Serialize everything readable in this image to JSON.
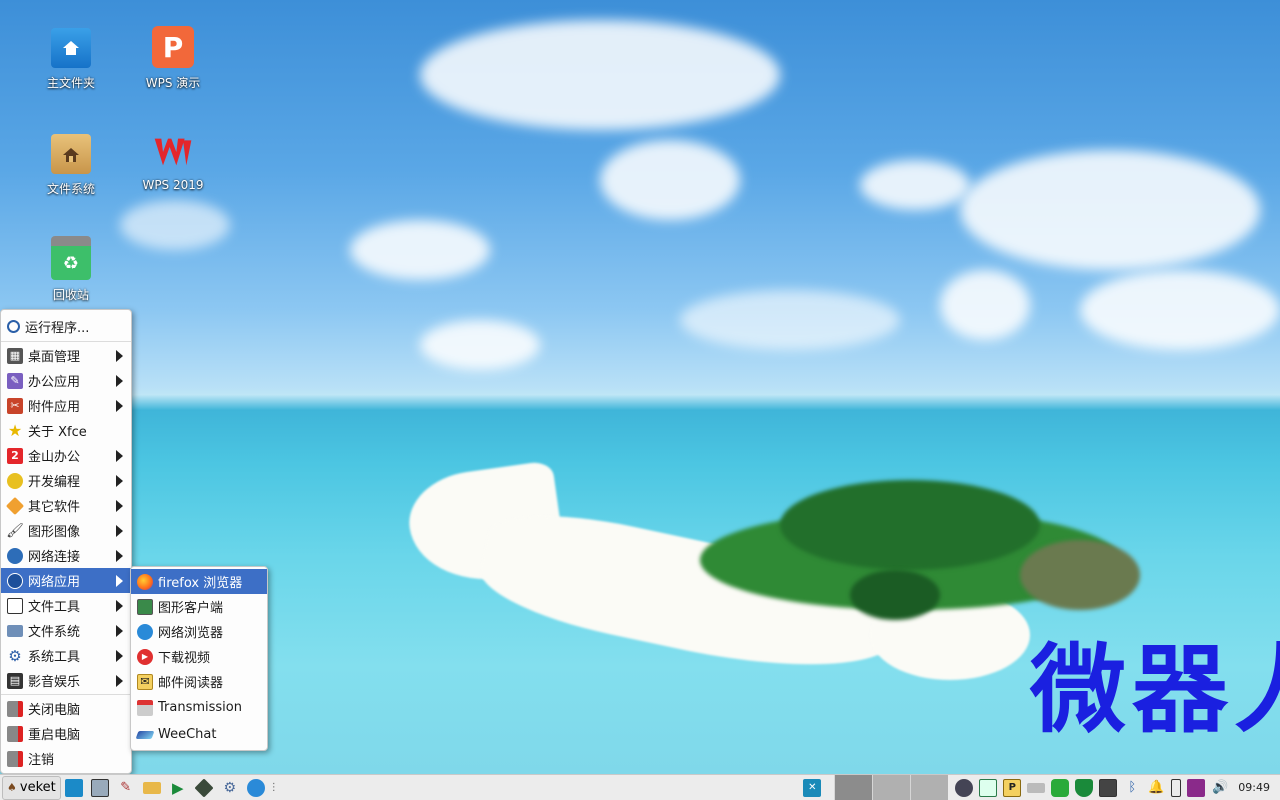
{
  "desktop": {
    "icons": [
      {
        "label": "主文件夹",
        "icon": "home-folder-icon"
      },
      {
        "label": "WPS 演示",
        "icon": "wps-presentation-icon"
      },
      {
        "label": "文件系统",
        "icon": "filesystem-icon"
      },
      {
        "label": "WPS 2019",
        "icon": "wps-icon"
      },
      {
        "label": "回收站",
        "icon": "trash-icon"
      }
    ],
    "watermark": "微器人"
  },
  "main_menu": {
    "run_program": "运行程序...",
    "items": [
      {
        "label": "桌面管理",
        "icon": "desktop-settings-icon",
        "submenu": true
      },
      {
        "label": "办公应用",
        "icon": "office-icon",
        "submenu": true
      },
      {
        "label": "附件应用",
        "icon": "accessories-icon",
        "submenu": true
      },
      {
        "label": "关于 Xfce",
        "icon": "star-icon",
        "submenu": false
      },
      {
        "label": "金山办公",
        "icon": "wps-office-icon",
        "submenu": true
      },
      {
        "label": "开发编程",
        "icon": "development-icon",
        "submenu": true
      },
      {
        "label": "其它软件",
        "icon": "other-software-icon",
        "submenu": true
      },
      {
        "label": "图形图像",
        "icon": "graphics-icon",
        "submenu": true
      },
      {
        "label": "网络连接",
        "icon": "network-connection-icon",
        "submenu": true
      },
      {
        "label": "网络应用",
        "icon": "internet-apps-icon",
        "submenu": true,
        "active": true
      },
      {
        "label": "文件工具",
        "icon": "file-tools-icon",
        "submenu": true
      },
      {
        "label": "文件系统",
        "icon": "folder-icon",
        "submenu": true
      },
      {
        "label": "系统工具",
        "icon": "system-tools-icon",
        "submenu": true
      },
      {
        "label": "影音娱乐",
        "icon": "multimedia-icon",
        "submenu": true
      }
    ],
    "session": [
      {
        "label": "关闭电脑",
        "icon": "shutdown-icon"
      },
      {
        "label": "重启电脑",
        "icon": "reboot-icon"
      },
      {
        "label": "注销",
        "icon": "logout-icon"
      }
    ]
  },
  "submenu": {
    "items": [
      {
        "label": "firefox 浏览器",
        "icon": "firefox-icon",
        "active": true
      },
      {
        "label": "图形客户端",
        "icon": "graphic-client-icon"
      },
      {
        "label": "网络浏览器",
        "icon": "web-browser-icon"
      },
      {
        "label": "下载视频",
        "icon": "download-video-icon"
      },
      {
        "label": "邮件阅读器",
        "icon": "mail-reader-icon"
      },
      {
        "label": "Transmission",
        "icon": "transmission-icon"
      },
      {
        "label": "WeeChat",
        "icon": "weechat-icon"
      }
    ]
  },
  "taskbar": {
    "start_label": "veket",
    "clock": "09:49",
    "colors": {
      "accent": "#3d6fc6",
      "bar": "#ececec"
    }
  }
}
